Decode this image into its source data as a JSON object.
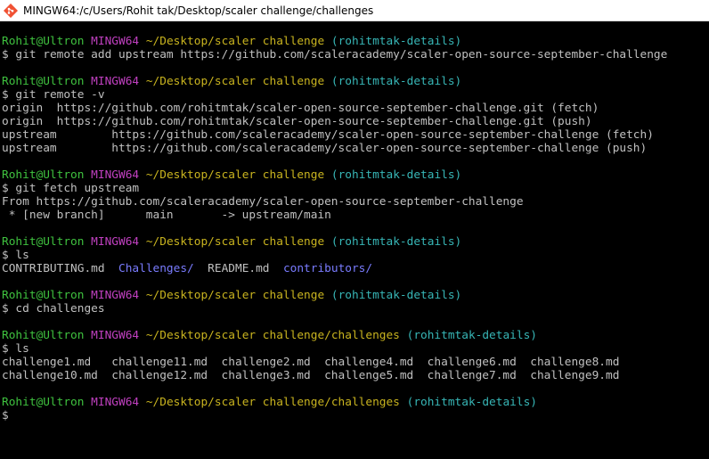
{
  "window": {
    "title": "MINGW64:/c/Users/Rohit tak/Desktop/scaler challenge/challenges",
    "icon": "git-bash-icon"
  },
  "colors": {
    "background": "#000000",
    "text": "#c0c0c0",
    "user": "#3fc23f",
    "mingw": "#c040c0",
    "path": "#c9b41f",
    "branch": "#37b6b6",
    "directory": "#7a7cff"
  },
  "prompt": {
    "user_host": "Rohit@Ultron",
    "system": "MINGW64",
    "symbol": "$"
  },
  "blocks": [
    {
      "path": "~/Desktop/scaler challenge",
      "branch": "(rohitmtak-details)",
      "command": "git remote add upstream https://github.com/scaleracademy/scaler-open-source-september-challenge",
      "output": []
    },
    {
      "path": "~/Desktop/scaler challenge",
      "branch": "(rohitmtak-details)",
      "command": "git remote -v",
      "output": [
        "origin  https://github.com/rohitmtak/scaler-open-source-september-challenge.git (fetch)",
        "origin  https://github.com/rohitmtak/scaler-open-source-september-challenge.git (push)",
        "upstream        https://github.com/scaleracademy/scaler-open-source-september-challenge (fetch)",
        "upstream        https://github.com/scaleracademy/scaler-open-source-september-challenge (push)"
      ]
    },
    {
      "path": "~/Desktop/scaler challenge",
      "branch": "(rohitmtak-details)",
      "command": "git fetch upstream",
      "output": [
        "From https://github.com/scaleracademy/scaler-open-source-september-challenge",
        " * [new branch]      main       -> upstream/main"
      ]
    },
    {
      "path": "~/Desktop/scaler challenge",
      "branch": "(rohitmtak-details)",
      "command": "ls",
      "ls_entries": [
        {
          "name": "CONTRIBUTING.md",
          "type": "file",
          "pad": "  "
        },
        {
          "name": "Challenges/",
          "type": "dir",
          "pad": "  "
        },
        {
          "name": "README.md",
          "type": "file",
          "pad": "  "
        },
        {
          "name": "contributors/",
          "type": "dir",
          "pad": ""
        }
      ]
    },
    {
      "path": "~/Desktop/scaler challenge",
      "branch": "(rohitmtak-details)",
      "command": "cd challenges",
      "output": []
    },
    {
      "path": "~/Desktop/scaler challenge/challenges",
      "branch": "(rohitmtak-details)",
      "command": "ls",
      "output": [
        "challenge1.md   challenge11.md  challenge2.md  challenge4.md  challenge6.md  challenge8.md",
        "challenge10.md  challenge12.md  challenge3.md  challenge5.md  challenge7.md  challenge9.md"
      ]
    }
  ],
  "final_prompt": {
    "path": "~/Desktop/scaler challenge/challenges",
    "branch": "(rohitmtak-details)"
  }
}
